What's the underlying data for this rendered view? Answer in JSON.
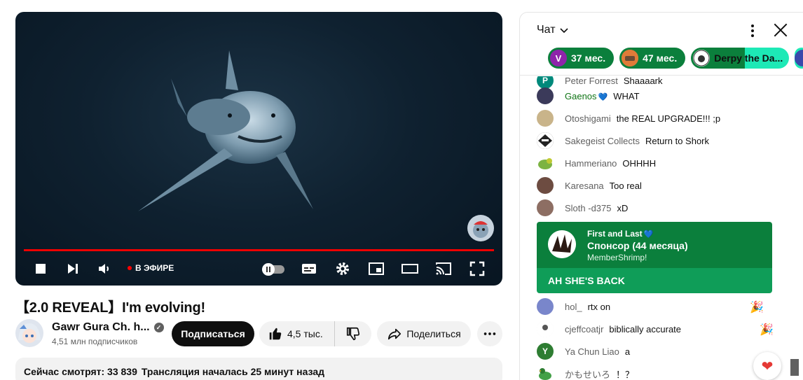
{
  "player": {
    "live_label": "В ЭФИРЕ"
  },
  "video": {
    "title": "【2.0 REVEAL】I'm evolving!",
    "channel_name": "Gawr Gura Ch. h...",
    "subscribers": "4,51 млн подписчиков",
    "subscribe_label": "Подписаться",
    "like_count": "4,5 тыс.",
    "share_label": "Поделиться",
    "viewers": "Сейчас смотрят: 33 839",
    "stream_started": "Трансляция началась 25 минут назад"
  },
  "chat": {
    "mode_label": "Чат",
    "ticker": [
      {
        "avatar_letter": "V",
        "label": "37 мес.",
        "color": "#0b7f3c",
        "avatar_color": "#8e24aa"
      },
      {
        "avatar_letter": "",
        "label": "47 мес.",
        "color": "#0b7f3c",
        "avatar_color": "#e07b39"
      },
      {
        "avatar_letter": "",
        "label": "Derpy the Da...",
        "color": "#1de9b6",
        "avatar_color": "#ffffff"
      }
    ],
    "messages": [
      {
        "author": "Peter Forrest",
        "text": "Shaaaark",
        "avatar_color": "#00897b",
        "avatar_letter": "P",
        "member": false
      },
      {
        "author": "Gaenos",
        "text": "WHAT",
        "avatar_color": "#3b3a5a",
        "avatar_letter": "",
        "member": true
      },
      {
        "author": "Otoshigami",
        "text": "the REAL UPGRADE!!! ;p",
        "avatar_color": "#c9b48a",
        "avatar_letter": "",
        "member": false
      },
      {
        "author": "Sakegeist Collects",
        "text": "Return to Shork",
        "avatar_color": "#222222",
        "avatar_letter": "",
        "member": false
      },
      {
        "author": "Hammeriano",
        "text": "OHHHH",
        "avatar_color": "#7cb342",
        "avatar_letter": "",
        "member": false
      },
      {
        "author": "Karesana",
        "text": "Too real",
        "avatar_color": "#6d4c41",
        "avatar_letter": "",
        "member": false
      },
      {
        "author": "Sloth -d375",
        "text": "xD",
        "avatar_color": "#8d6e63",
        "avatar_letter": "",
        "member": false
      },
      {
        "author": "hol_",
        "text": "rtx on",
        "avatar_color": "#7986cb",
        "avatar_letter": "",
        "member": false
      },
      {
        "author": "cjeffcoatjr",
        "text": "biblically accurate",
        "avatar_color": "#eeeeee",
        "avatar_letter": "",
        "member": false
      },
      {
        "author": "Ya Chun Liao",
        "text": "a",
        "avatar_color": "#2e7d32",
        "avatar_letter": "Y",
        "member": false
      },
      {
        "author": "かもせいろ",
        "text": "！？",
        "avatar_color": "#43a047",
        "avatar_letter": "",
        "member": false
      }
    ],
    "sponsor": {
      "name": "First and Last",
      "level": "Спонсор (44 месяца)",
      "subtitle": "MemberShrimp!",
      "message": "AH SHE'S BACK"
    },
    "react_icon": "heart-icon"
  }
}
